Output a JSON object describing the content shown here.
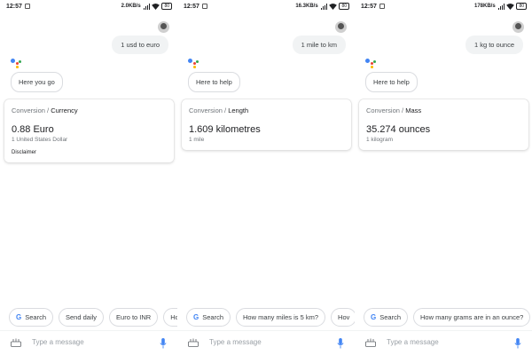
{
  "colors": {
    "mic": "#4285f4",
    "google_g": "#4285f4",
    "assistant_dots": [
      "#4285f4",
      "#ea4335",
      "#fbbc05",
      "#34a853"
    ]
  },
  "screens": [
    {
      "status": {
        "time": "12:57",
        "speed": "2.0KB/s",
        "battery": "80"
      },
      "user_query": "1 usd to euro",
      "reply": "Here you go",
      "card": {
        "category_prefix": "Conversion",
        "separator": " / ",
        "category": "Currency",
        "value": "0.88 Euro",
        "source": "1 United States Dollar",
        "disclaimer": "Disclaimer"
      },
      "chips": [
        {
          "label": "Search",
          "icon": "google-g-icon"
        },
        {
          "label": "Send daily"
        },
        {
          "label": "Euro to INR"
        },
        {
          "label": "Ho"
        }
      ],
      "input_placeholder": "Type a message"
    },
    {
      "status": {
        "time": "12:57",
        "speed": "16.3KB/s",
        "battery": "80"
      },
      "user_query": "1 mile to km",
      "reply": "Here to help",
      "card": {
        "category_prefix": "Conversion",
        "separator": " / ",
        "category": "Length",
        "value": "1.609 kilometres",
        "source": "1 mile"
      },
      "chips": [
        {
          "label": "Search",
          "icon": "google-g-icon"
        },
        {
          "label": "How many miles is 5 km?"
        },
        {
          "label": "Hov"
        }
      ],
      "input_placeholder": "Type a message"
    },
    {
      "status": {
        "time": "12:57",
        "speed": "178KB/s",
        "battery": "80"
      },
      "user_query": "1 kg to ounce",
      "reply": "Here to help",
      "card": {
        "category_prefix": "Conversion",
        "separator": " / ",
        "category": "Mass",
        "value": "35.274 ounces",
        "source": "1 kilogram"
      },
      "chips": [
        {
          "label": "Search",
          "icon": "google-g-icon"
        },
        {
          "label": "How many grams are in an ounce?"
        }
      ],
      "input_placeholder": "Type a message"
    }
  ]
}
